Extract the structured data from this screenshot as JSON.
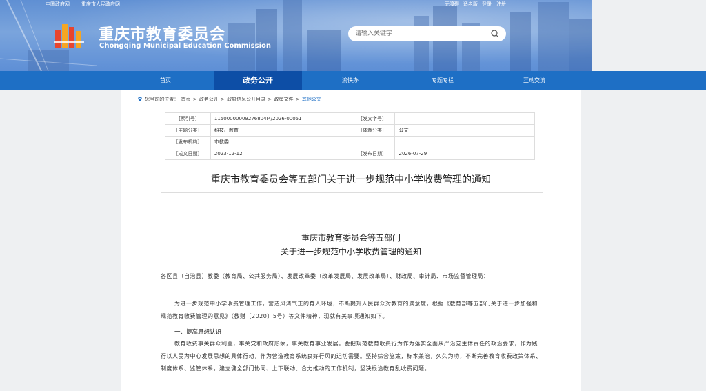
{
  "topbar": {
    "links_left": [
      "中国政府网",
      "重庆市人民政府网"
    ],
    "links_right": [
      "无障碍",
      "适老版",
      "登录",
      "注册"
    ]
  },
  "header": {
    "title": "重庆市教育委员会",
    "subtitle": "Chongqing Municipal Education Commission",
    "search_placeholder": "请输入关键字"
  },
  "nav": {
    "items": [
      {
        "label": "首页"
      },
      {
        "label": "政务公开"
      },
      {
        "label": "渝快办"
      },
      {
        "label": "专题专栏"
      },
      {
        "label": "互动交流"
      }
    ]
  },
  "breadcrumb": {
    "prefix": "您当前的位置：",
    "items": [
      "首页",
      "政务公开",
      "政府信息公开目录",
      "政策文件",
      "其他公文"
    ],
    "separator": ">"
  },
  "meta": {
    "rows": [
      {
        "k1": "［索引号］",
        "v1": "11500000009276804M/2026-00051",
        "k2": "［发文字号］",
        "v2": ""
      },
      {
        "k1": "［主题分类］",
        "v1": "科技、教育",
        "k2": "［体裁分类］",
        "v2": "公文"
      },
      {
        "k1": "［发布机构］",
        "v1": "市教委",
        "k2": "",
        "v2": ""
      },
      {
        "k1": "［成文日期］",
        "v1": "2023-12-12",
        "k2": "［发布日期］",
        "v2": "2026-07-29"
      }
    ]
  },
  "doc": {
    "title": "重庆市教育委员会等五部门关于进一步规范中小学收费管理的通知",
    "heading_line1": "重庆市教育委员会等五部门",
    "heading_line2": "关于进一步规范中小学收费管理的通知",
    "recipients": "各区县（自治县）教委（教育局、公共服务局）、发展改革委（改革发展局、发展改革局）、财政局、审计局、市场监督管理局：",
    "intro": "为进一步规范中小学收费管理工作，营造风清气正的育人环境，不断提升人民群众对教育的满意度，根据《教育部等五部门关于进一步加强和规范教育收费管理的意见》（教财〔2020〕5号）等文件精神，现就有关事项通知如下。",
    "section1": "一、提高思想认识",
    "section1_text": "教育收费事关群众利益，事关党和政府形象，事关教育事业发展。要把规范教育收费行为作为落实全面从严治党主体责任的政治要求，作为践行以人民为中心发展思想的具体行动，作为营造教育系统良好行风的迫切需要。坚持综合施策，标本兼治，久久为功，不断完善教育收费政策体系、制度体系、监管体系，建立健全部门协同、上下联动、合力推动的工作机制，坚决根治教育乱收费问题。"
  }
}
